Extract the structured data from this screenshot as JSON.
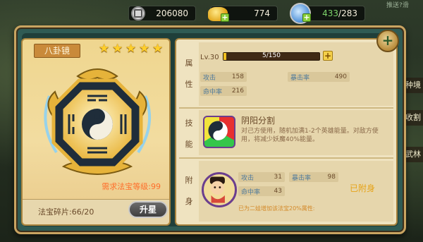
{
  "resources": {
    "silver": "206080",
    "gold": "774",
    "stamina_current": "433",
    "stamina_sep_max": "/283",
    "top_right": "推送?滑"
  },
  "side_tabs": [
    "种境",
    "收割",
    "武林"
  ],
  "treasure": {
    "name": "八卦镜",
    "stars": 5,
    "star_glyph": "★",
    "requirement": "需求法宝等级:99",
    "fragments": "法宝碎片:66/20",
    "upgrade_label": "升星"
  },
  "attributes": {
    "section_label_1": "属",
    "section_label_2": "性",
    "level": "Lv.30",
    "exp_text": "5/150",
    "exp_fraction": 0.033,
    "plus": "+",
    "stats": [
      {
        "name": "攻击",
        "value": "158"
      },
      {
        "name": "暴击率",
        "value": "490"
      },
      {
        "name": "命中率",
        "value": "216"
      }
    ]
  },
  "skill": {
    "section_label_1": "技",
    "section_label_2": "能",
    "name": "阴阳分割",
    "description": "对己方使用，随机加满1-2个英雄能量。对敌方使用，将减少妖魔40%能量。"
  },
  "attach": {
    "section_label_1": "附",
    "section_label_2": "身",
    "stats": [
      {
        "name": "攻击",
        "value": "31"
      },
      {
        "name": "暴击率",
        "value": "98"
      },
      {
        "name": "命中率",
        "value": "43"
      }
    ],
    "status": "已附身",
    "note": "已为二娃增加该法宝20%属性:"
  },
  "close_label": "+",
  "colors": {
    "frame": "#2f5b54",
    "border_gold": "#c9a461",
    "panel": "#efe3c0",
    "star": "#ffcf2a",
    "highlight_orange": "#ff6e2a",
    "attached": "#e6a317",
    "stat_name": "#4e7a9c"
  }
}
